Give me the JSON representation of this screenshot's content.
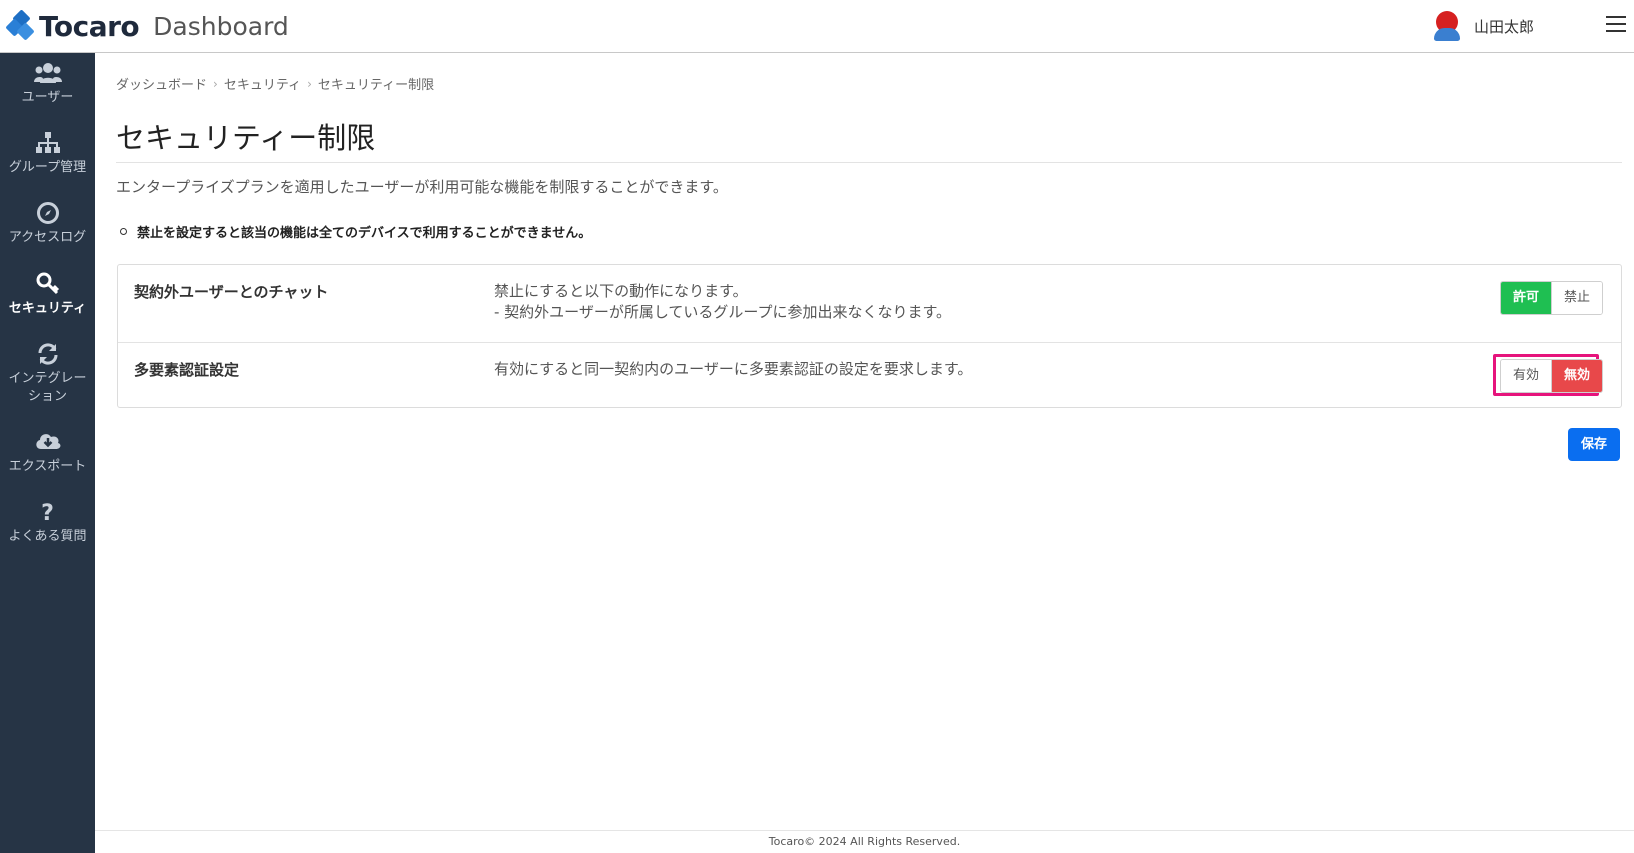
{
  "header": {
    "brand": "Tocaro",
    "app_name": "Dashboard",
    "user_name": "山田太郎",
    "colors": {
      "brand_blue": "#1e6fc4",
      "avatar_red": "#d62020",
      "avatar_blue": "#3a7fd0"
    }
  },
  "sidebar": {
    "background": "#263445",
    "items": [
      {
        "label": "ユーザー",
        "icon": "users-icon",
        "active": false
      },
      {
        "label": "グループ管理",
        "icon": "sitemap-icon",
        "active": false
      },
      {
        "label": "アクセスログ",
        "icon": "compass-icon",
        "active": false
      },
      {
        "label": "セキュリティ",
        "icon": "key-icon",
        "active": true
      },
      {
        "label": "インテグレーション",
        "icon": "sync-icon",
        "active": false
      },
      {
        "label": "エクスポート",
        "icon": "cloud-download-icon",
        "active": false
      },
      {
        "label": "よくある質問",
        "icon": "question-icon",
        "active": false
      }
    ],
    "labels_wrapped": {
      "integration_line1": "インテグレー",
      "integration_line2": "ション"
    }
  },
  "breadcrumb": [
    "ダッシュボード",
    "セキュリティ",
    "セキュリティー制限"
  ],
  "page": {
    "title": "セキュリティー制限",
    "description": "エンタープライズプランを適用したユーザーが利用可能な機能を制限することができます。",
    "note": "禁止を設定すると該当の機能は全てのデバイスで利用することができません。"
  },
  "settings": [
    {
      "label": "契約外ユーザーとのチャット",
      "desc_line1": "禁止にすると以下の動作になります。",
      "desc_line2": "- 契約外ユーザーが所属しているグループに参加出来なくなります。",
      "options": [
        "許可",
        "禁止"
      ],
      "selected": "許可",
      "selected_color": "#1fbf52"
    },
    {
      "label": "多要素認証設定",
      "desc_line1": "有効にすると同一契約内のユーザーに多要素認証の設定を要求します。",
      "options": [
        "有効",
        "無効"
      ],
      "selected": "無効",
      "selected_color": "#e8484a",
      "highlight_color": "#e6147c"
    }
  ],
  "save_label": "保存",
  "save_color": "#0a6ef0",
  "footer": "Tocaro© 2024 All Rights Reserved."
}
